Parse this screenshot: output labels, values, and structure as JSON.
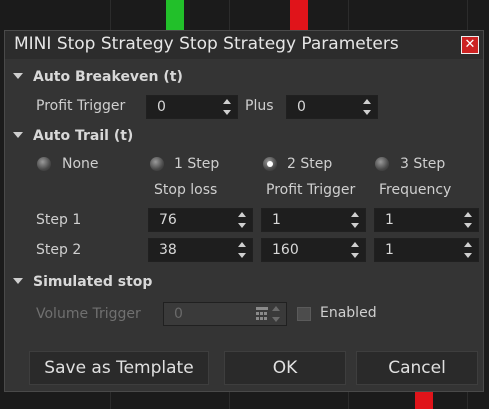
{
  "window": {
    "title": "MINI Stop Strategy  Stop Strategy Parameters"
  },
  "auto_breakeven": {
    "header": "Auto Breakeven (t)",
    "profit_trigger_label": "Profit Trigger",
    "profit_trigger_value": "0",
    "plus_label": "Plus",
    "plus_value": "0"
  },
  "auto_trail": {
    "header": "Auto Trail (t)",
    "options": [
      "None",
      "1 Step",
      "2 Step",
      "3 Step"
    ],
    "selected": "2 Step",
    "columns": [
      "Stop loss",
      "Profit Trigger",
      "Frequency"
    ],
    "rows": [
      {
        "label": "Step 1",
        "values": [
          "76",
          "1",
          "1"
        ]
      },
      {
        "label": "Step 2",
        "values": [
          "38",
          "160",
          "1"
        ]
      }
    ]
  },
  "simulated_stop": {
    "header": "Simulated stop",
    "volume_trigger_label": "Volume Trigger",
    "volume_trigger_value": "0",
    "enabled_label": "Enabled",
    "enabled": false
  },
  "buttons": {
    "save_template": "Save as Template",
    "ok": "OK",
    "cancel": "Cancel"
  },
  "colors": {
    "accent_red": "#cc2222",
    "candle_green": "#22c02a",
    "candle_red": "#e0141a"
  }
}
